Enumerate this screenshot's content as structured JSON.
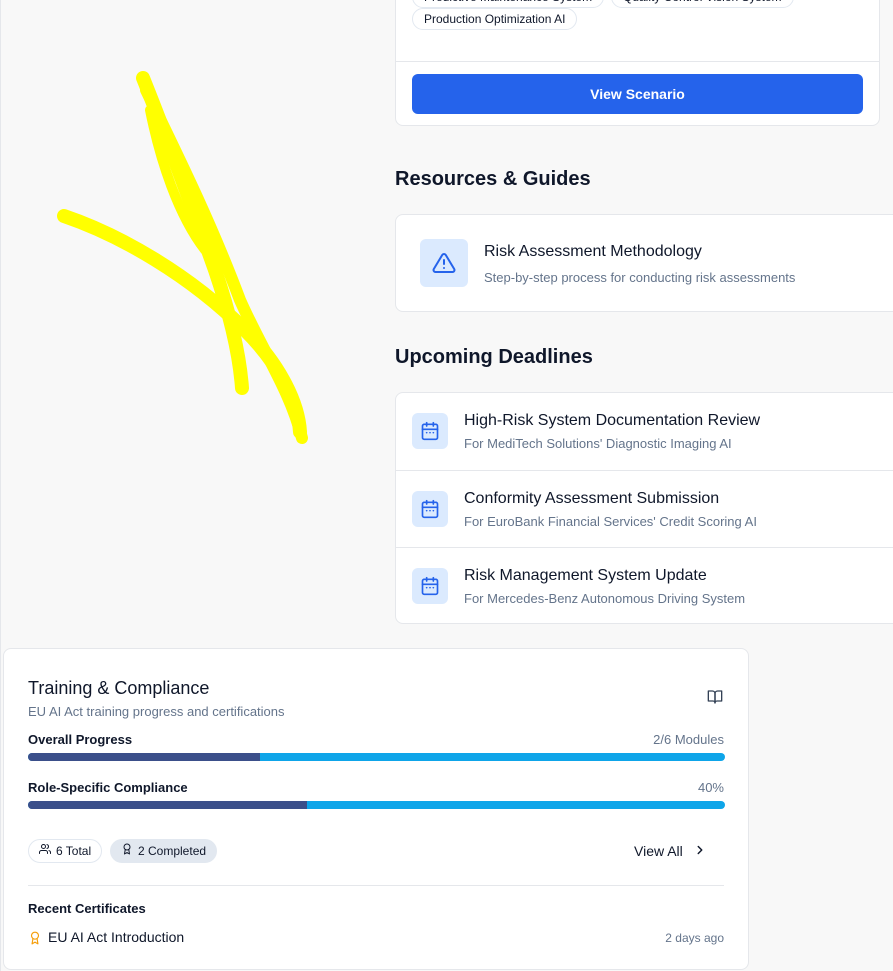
{
  "scenario": {
    "tags": [
      "Predictive Maintenance System",
      "Quality Control Vision System",
      "Production Optimization AI"
    ],
    "button_label": "View Scenario"
  },
  "resources": {
    "heading": "Resources & Guides",
    "items": [
      {
        "title": "Risk Assessment Methodology",
        "description": "Step-by-step process for conducting risk assessments",
        "icon": "alert-triangle-icon"
      }
    ]
  },
  "deadlines": {
    "heading": "Upcoming Deadlines",
    "items": [
      {
        "title": "High-Risk System Documentation Review",
        "subtitle": "For MediTech Solutions' Diagnostic Imaging AI",
        "icon": "calendar-icon"
      },
      {
        "title": "Conformity Assessment Submission",
        "subtitle": "For EuroBank Financial Services' Credit Scoring AI",
        "icon": "calendar-icon"
      },
      {
        "title": "Risk Management System Update",
        "subtitle": "For Mercedes-Benz Autonomous Driving System",
        "icon": "calendar-icon"
      }
    ]
  },
  "training": {
    "title": "Training & Compliance",
    "subtitle": "EU AI Act training progress and certifications",
    "overall": {
      "label": "Overall Progress",
      "value": "2/6 Modules",
      "fraction": 0.333
    },
    "role": {
      "label": "Role-Specific Compliance",
      "value": "40%",
      "fraction": 0.4
    },
    "badges": {
      "total": "6 Total",
      "completed": "2 Completed"
    },
    "view_all": "View All",
    "recent_label": "Recent Certificates",
    "certificates": [
      {
        "name": "EU AI Act Introduction",
        "time": "2 days ago"
      }
    ]
  },
  "colors": {
    "primary": "#2563eb",
    "progress_fill": "#3b4f8a",
    "progress_track": "#0ea5e9",
    "icon_bg": "#dbeafe",
    "annotation": "#ffff00",
    "award": "#f59e0b"
  }
}
